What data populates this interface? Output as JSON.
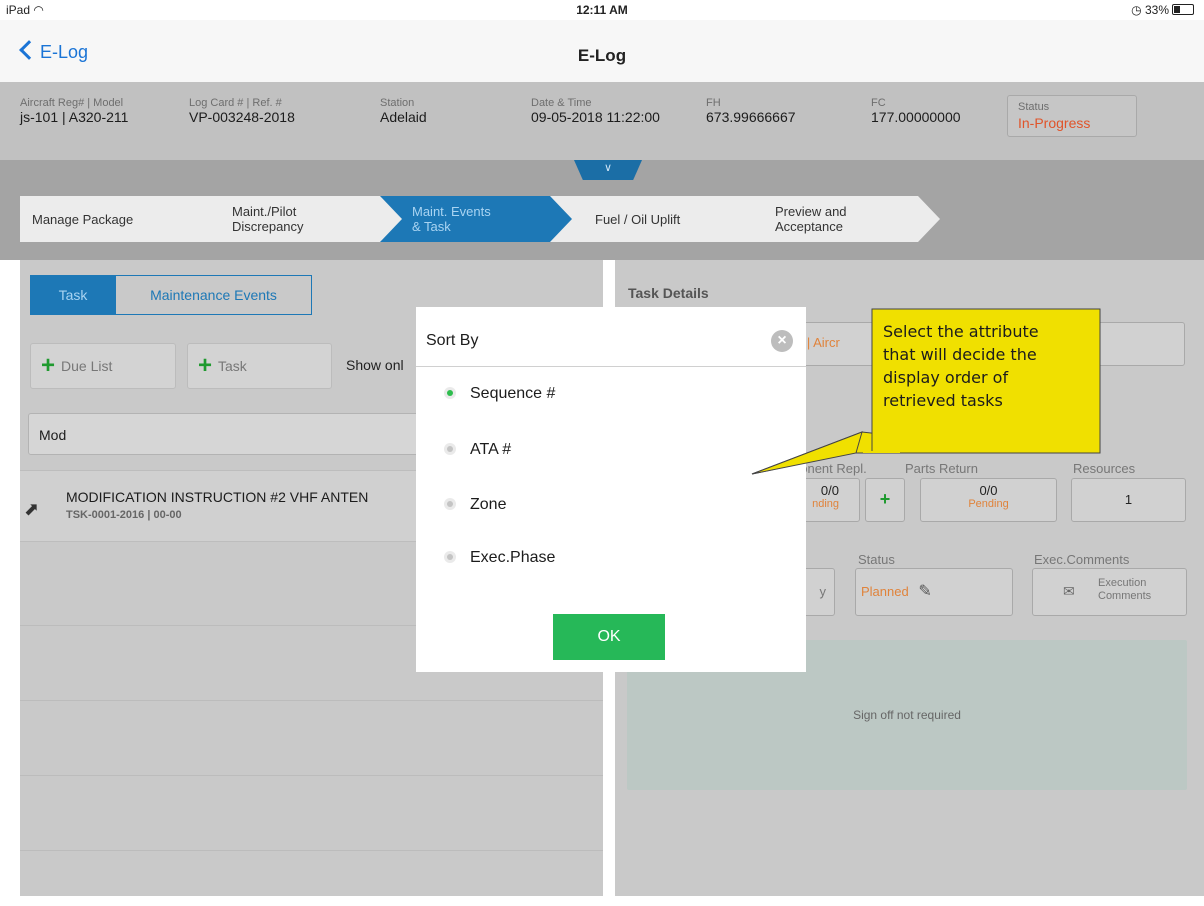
{
  "status_bar": {
    "device": "iPad",
    "time": "12:11 AM",
    "battery": "33%"
  },
  "nav": {
    "back_label": "E-Log",
    "title": "E-Log"
  },
  "header_fields": {
    "aircraft": {
      "label": "Aircraft Reg# | Model",
      "value": "js-101 | A320-211"
    },
    "log_card": {
      "label": "Log Card # | Ref. #",
      "value": "VP-003248-2018"
    },
    "station": {
      "label": "Station",
      "value": "Adelaid"
    },
    "date_time": {
      "label": "Date & Time",
      "value": "09-05-2018 11:22:00"
    },
    "fh": {
      "label": "FH",
      "value": "673.99666667"
    },
    "fc": {
      "label": "FC",
      "value": "177.00000000"
    },
    "status": {
      "label": "Status",
      "value": "In-Progress"
    }
  },
  "tabs": [
    {
      "line1": "Manage Package",
      "line2": ""
    },
    {
      "line1": "Maint./Pilot",
      "line2": "Discrepancy"
    },
    {
      "line1": "Maint. Events",
      "line2": "& Task"
    },
    {
      "line1": "Fuel / Oil Uplift",
      "line2": ""
    },
    {
      "line1": "Preview and",
      "line2": "Acceptance"
    }
  ],
  "left_panel": {
    "segments": [
      "Task",
      "Maintenance Events"
    ],
    "due_list_label": "Due List",
    "task_button_label": "Task",
    "show_only_text": "Show onl",
    "search_value": "Mod",
    "task": {
      "title": "MODIFICATION INSTRUCTION #2 VHF ANTEN",
      "sub": "TSK-0001-2016 | 00-00"
    }
  },
  "right_panel": {
    "title": "Task Details",
    "ref_fragment": "0 | Aircr",
    "columns": {
      "component": "ponent Repl.",
      "parts_return": "Parts Return",
      "resources": "Resources",
      "status": "Status",
      "exec_comments": "Exec.Comments"
    },
    "component_value": "0/0",
    "component_status": "nding",
    "parts_value": "0/0",
    "parts_status": "Pending",
    "resources_value": "1",
    "left_fragment": "y",
    "status_value": "Planned",
    "exec_line1": "Execution",
    "exec_line2": "Comments",
    "sign_off": "Sign off not required"
  },
  "dialog": {
    "title": "Sort By",
    "options": [
      "Sequence #",
      "ATA #",
      "Zone",
      "Exec.Phase"
    ],
    "selected_index": 0,
    "ok_label": "OK"
  },
  "callout": {
    "lines": [
      "Select the attribute",
      "that will decide the",
      "display order of",
      "retrieved tasks"
    ],
    "color": "#f0e000"
  },
  "icons": [
    "wifi-icon",
    "alarm-icon",
    "battery-icon",
    "back-chevron-icon",
    "expand-chevron-icon",
    "plus-icon",
    "open-task-icon",
    "close-icon",
    "edit-icon",
    "comment-icon"
  ]
}
